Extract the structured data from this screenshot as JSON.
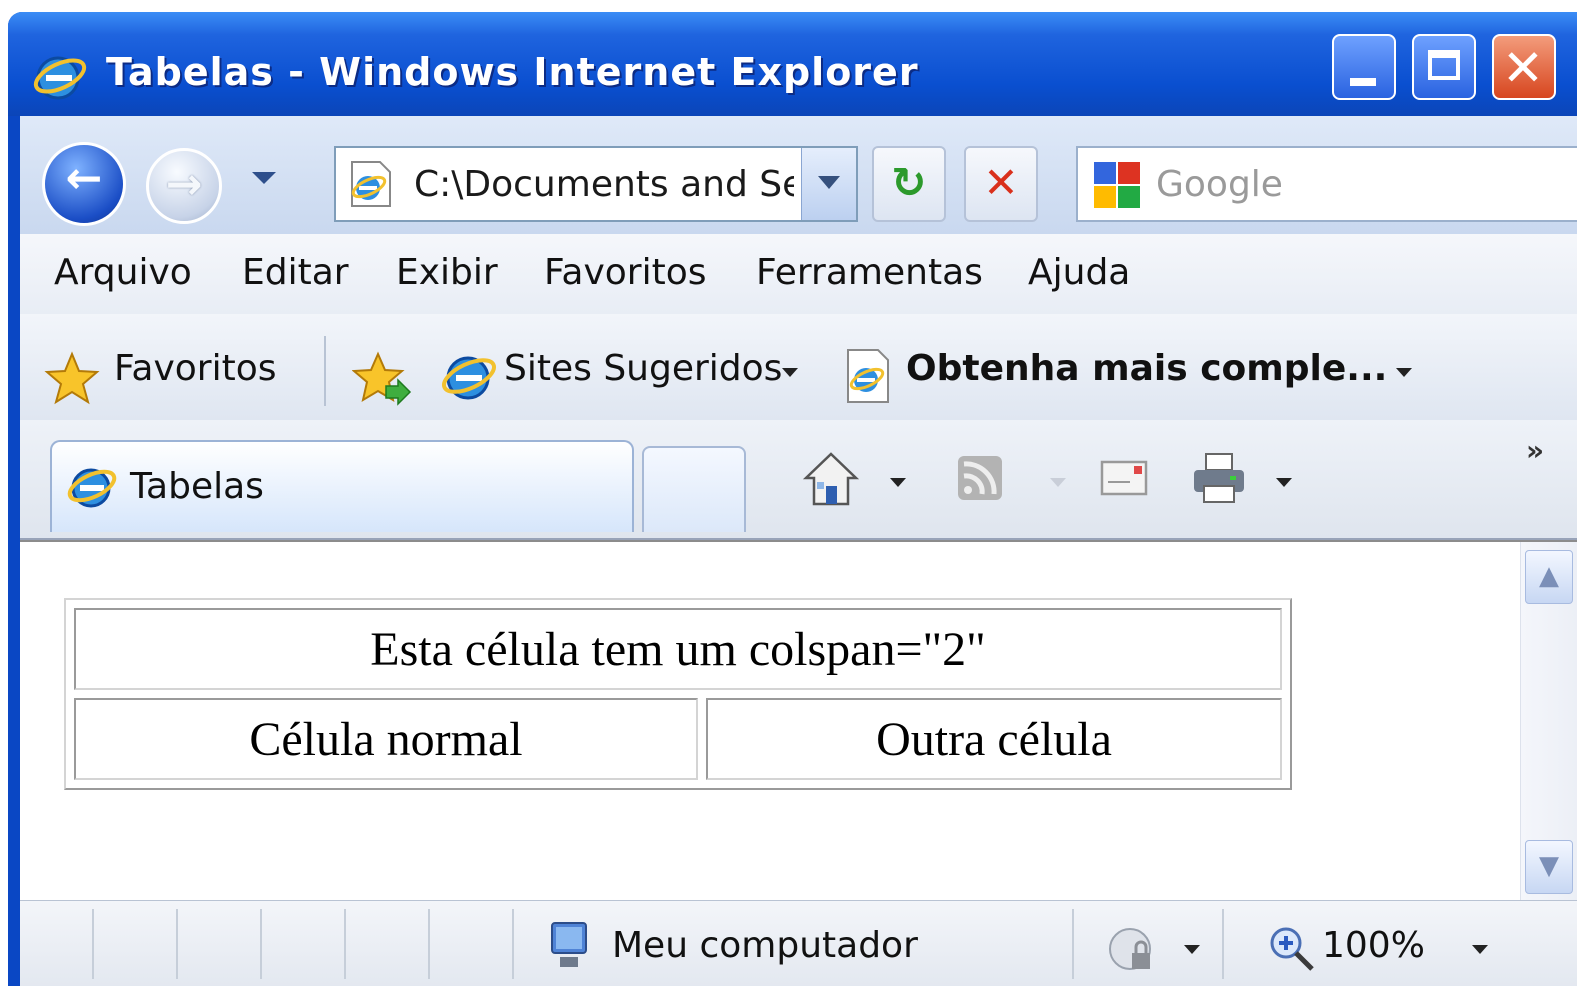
{
  "window": {
    "title": "Tabelas - Windows Internet Explorer",
    "controls": {
      "minimize": "minimize",
      "maximize": "maximize",
      "close": "✕"
    }
  },
  "navbar": {
    "back_arrow": "←",
    "forward_arrow": "→",
    "address": "C:\\Documents and Set",
    "refresh_glyph": "↻",
    "stop_glyph": "✕",
    "search_placeholder": "Google"
  },
  "menu": [
    "Arquivo",
    "Editar",
    "Exibir",
    "Favoritos",
    "Ferramentas",
    "Ajuda"
  ],
  "favorites_bar": {
    "favorites_label": "Favoritos",
    "suggested_sites": "Sites Sugeridos",
    "get_more": "Obtenha mais comple..."
  },
  "tabs": {
    "active_label": "Tabelas",
    "overflow_glyph": "»"
  },
  "page": {
    "table": {
      "header_cell": "Esta célula tem um colspan=\"2\"",
      "row": [
        "Célula normal",
        "Outra célula"
      ]
    }
  },
  "statusbar": {
    "zone": "Meu computador",
    "zoom": "100%"
  },
  "icons": [
    "ie-icon",
    "back-icon",
    "forward-icon",
    "refresh-icon",
    "stop-icon",
    "google-icon",
    "star-icon",
    "add-favorite-icon",
    "page-icon",
    "home-icon",
    "rss-icon",
    "mail-icon",
    "print-icon",
    "computer-icon",
    "protected-mode-icon",
    "zoom-icon"
  ],
  "colors": {
    "titlebar": "#0a4fd0",
    "close_button": "#d7461f",
    "window_frame": "#0a47c4"
  }
}
